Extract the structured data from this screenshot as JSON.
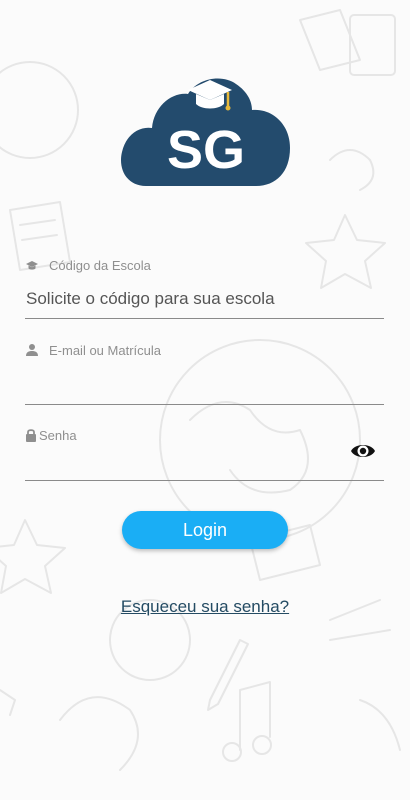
{
  "logo": {
    "text": "SG",
    "icon": "graduation-cap-cloud-logo",
    "cloud_color": "#234b6d",
    "cap_color": "#ffffff",
    "tassel_color": "#e8b93a"
  },
  "form": {
    "school_code": {
      "icon": "graduation-cap-icon",
      "label": "Código da Escola",
      "value": "Solicite o código para sua escola"
    },
    "email": {
      "icon": "person-icon",
      "label": "E-mail ou Matrícula",
      "value": ""
    },
    "password": {
      "icon": "lock-icon",
      "label": "Senha",
      "value": "",
      "toggle_icon": "eye-icon"
    }
  },
  "login_button": {
    "label": "Login",
    "color": "#1aaef5"
  },
  "forgot_password": {
    "label": "Esqueceu sua senha?",
    "color": "#244b63"
  }
}
